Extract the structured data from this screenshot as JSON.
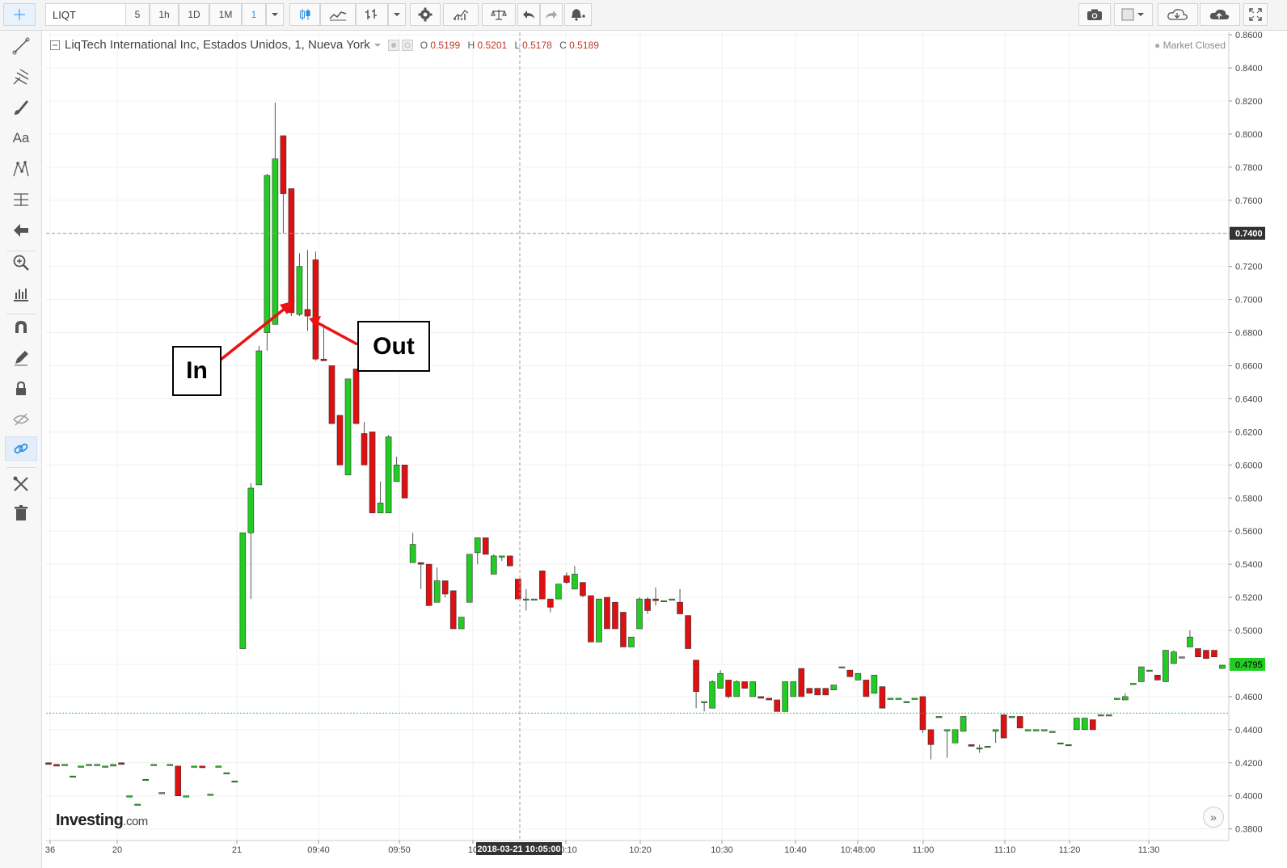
{
  "toolbar": {
    "symbol": "LIQT",
    "intervals": [
      "5",
      "1h",
      "1D",
      "1M",
      "1"
    ],
    "active_interval": "1"
  },
  "legend": {
    "title": "LiqTech International Inc, Estados Unidos, 1, Nueva York",
    "open_label": "O",
    "open": "0.5199",
    "high_label": "H",
    "high": "0.5201",
    "low_label": "L",
    "low": "0.5178",
    "close_label": "C",
    "close": "0.5189"
  },
  "status": "Market Closed",
  "annotations": {
    "in": "In",
    "out": "Out"
  },
  "brand": {
    "name": "Investing",
    "suffix": ".com"
  },
  "crosshair": {
    "time_label": "2018-03-21 10:05:00",
    "price_label": "0.7400"
  },
  "last_price_label": "0.4795",
  "colors": {
    "up": "#22cc22",
    "down": "#dd1111",
    "crosshair": "#999999",
    "last_price": "#22cc22",
    "arrows": "#ee1111"
  },
  "chart_data": {
    "type": "candlestick",
    "y_axis_labels": [
      "0.8600",
      "0.8400",
      "0.8200",
      "0.8000",
      "0.7800",
      "0.7600",
      "0.7400",
      "0.7200",
      "0.7000",
      "0.6800",
      "0.6600",
      "0.6400",
      "0.6200",
      "0.6000",
      "0.5800",
      "0.5600",
      "0.5400",
      "0.5200",
      "0.5000",
      "0.4795",
      "0.4600",
      "0.4400",
      "0.4200",
      "0.4000",
      "0.3800"
    ],
    "x_axis_labels": [
      "36",
      "20",
      "21",
      "09:40",
      "09:50",
      "10",
      "10:10",
      "10:20",
      "10:30",
      "10:40",
      "10:48:00",
      "11:00",
      "11:10",
      "11:20",
      "11:30"
    ],
    "ylim": [
      0.373,
      0.8615
    ],
    "grid": true,
    "candles": [
      {
        "o": 0.42,
        "h": 0.42,
        "l": 0.419,
        "c": 0.419
      },
      {
        "o": 0.419,
        "h": 0.419,
        "l": 0.418,
        "c": 0.418
      },
      {
        "o": 0.419,
        "h": 0.419,
        "l": 0.419,
        "c": 0.419
      },
      {
        "o": 0.412,
        "h": 0.412,
        "l": 0.412,
        "c": 0.412
      },
      {
        "o": 0.418,
        "h": 0.418,
        "l": 0.418,
        "c": 0.418
      },
      {
        "o": 0.419,
        "h": 0.419,
        "l": 0.419,
        "c": 0.419
      },
      {
        "o": 0.419,
        "h": 0.419,
        "l": 0.419,
        "c": 0.419
      },
      {
        "o": 0.418,
        "h": 0.418,
        "l": 0.418,
        "c": 0.418
      },
      {
        "o": 0.418,
        "h": 0.419,
        "l": 0.418,
        "c": 0.419
      },
      {
        "o": 0.42,
        "h": 0.42,
        "l": 0.419,
        "c": 0.419
      },
      {
        "o": 0.4,
        "h": 0.4,
        "l": 0.4,
        "c": 0.4
      },
      {
        "o": 0.395,
        "h": 0.395,
        "l": 0.395,
        "c": 0.395
      },
      {
        "o": 0.41,
        "h": 0.41,
        "l": 0.41,
        "c": 0.41
      },
      {
        "o": 0.419,
        "h": 0.419,
        "l": 0.419,
        "c": 0.419
      },
      {
        "o": 0.402,
        "h": 0.402,
        "l": 0.402,
        "c": 0.402
      },
      {
        "o": 0.419,
        "h": 0.419,
        "l": 0.419,
        "c": 0.419
      },
      {
        "o": 0.418,
        "h": 0.418,
        "l": 0.4,
        "c": 0.4
      },
      {
        "o": 0.4,
        "h": 0.4,
        "l": 0.4,
        "c": 0.4
      },
      {
        "o": 0.418,
        "h": 0.418,
        "l": 0.418,
        "c": 0.418
      },
      {
        "o": 0.418,
        "h": 0.418,
        "l": 0.417,
        "c": 0.417
      },
      {
        "o": 0.401,
        "h": 0.401,
        "l": 0.401,
        "c": 0.401
      },
      {
        "o": 0.418,
        "h": 0.418,
        "l": 0.418,
        "c": 0.418
      },
      {
        "o": 0.414,
        "h": 0.414,
        "l": 0.414,
        "c": 0.414
      },
      {
        "o": 0.409,
        "h": 0.409,
        "l": 0.409,
        "c": 0.409
      },
      {
        "o": 0.489,
        "h": 0.559,
        "l": 0.489,
        "c": 0.559
      },
      {
        "o": 0.559,
        "h": 0.589,
        "l": 0.519,
        "c": 0.586
      },
      {
        "o": 0.588,
        "h": 0.672,
        "l": 0.588,
        "c": 0.669
      },
      {
        "o": 0.68,
        "h": 0.776,
        "l": 0.669,
        "c": 0.775
      },
      {
        "o": 0.685,
        "h": 0.819,
        "l": 0.685,
        "c": 0.785
      },
      {
        "o": 0.799,
        "h": 0.799,
        "l": 0.74,
        "c": 0.764
      },
      {
        "o": 0.767,
        "h": 0.767,
        "l": 0.69,
        "c": 0.692
      },
      {
        "o": 0.691,
        "h": 0.728,
        "l": 0.69,
        "c": 0.72
      },
      {
        "o": 0.694,
        "h": 0.73,
        "l": 0.681,
        "c": 0.69
      },
      {
        "o": 0.724,
        "h": 0.729,
        "l": 0.663,
        "c": 0.664
      },
      {
        "o": 0.664,
        "h": 0.685,
        "l": 0.664,
        "c": 0.663
      },
      {
        "o": 0.66,
        "h": 0.66,
        "l": 0.625,
        "c": 0.625
      },
      {
        "o": 0.63,
        "h": 0.63,
        "l": 0.6,
        "c": 0.6
      },
      {
        "o": 0.594,
        "h": 0.652,
        "l": 0.594,
        "c": 0.652
      },
      {
        "o": 0.658,
        "h": 0.658,
        "l": 0.625,
        "c": 0.625
      },
      {
        "o": 0.619,
        "h": 0.626,
        "l": 0.6,
        "c": 0.6
      },
      {
        "o": 0.62,
        "h": 0.62,
        "l": 0.572,
        "c": 0.571
      },
      {
        "o": 0.571,
        "h": 0.59,
        "l": 0.571,
        "c": 0.577
      },
      {
        "o": 0.571,
        "h": 0.618,
        "l": 0.571,
        "c": 0.617
      },
      {
        "o": 0.59,
        "h": 0.605,
        "l": 0.59,
        "c": 0.6
      },
      {
        "o": 0.6,
        "h": 0.6,
        "l": 0.58,
        "c": 0.58
      },
      {
        "o": 0.541,
        "h": 0.559,
        "l": 0.541,
        "c": 0.552
      },
      {
        "o": 0.541,
        "h": 0.541,
        "l": 0.525,
        "c": 0.54
      },
      {
        "o": 0.54,
        "h": 0.54,
        "l": 0.515,
        "c": 0.515
      },
      {
        "o": 0.517,
        "h": 0.538,
        "l": 0.517,
        "c": 0.53
      },
      {
        "o": 0.53,
        "h": 0.53,
        "l": 0.52,
        "c": 0.522
      },
      {
        "o": 0.524,
        "h": 0.524,
        "l": 0.501,
        "c": 0.501
      },
      {
        "o": 0.501,
        "h": 0.508,
        "l": 0.501,
        "c": 0.508
      },
      {
        "o": 0.517,
        "h": 0.546,
        "l": 0.517,
        "c": 0.546
      },
      {
        "o": 0.547,
        "h": 0.556,
        "l": 0.54,
        "c": 0.556
      },
      {
        "o": 0.556,
        "h": 0.556,
        "l": 0.546,
        "c": 0.546
      },
      {
        "o": 0.534,
        "h": 0.546,
        "l": 0.534,
        "c": 0.545
      },
      {
        "o": 0.545,
        "h": 0.545,
        "l": 0.542,
        "c": 0.545
      },
      {
        "o": 0.545,
        "h": 0.545,
        "l": 0.539,
        "c": 0.539
      },
      {
        "o": 0.531,
        "h": 0.531,
        "l": 0.52,
        "c": 0.519
      },
      {
        "o": 0.519,
        "h": 0.525,
        "l": 0.512,
        "c": 0.519
      },
      {
        "o": 0.519,
        "h": 0.519,
        "l": 0.519,
        "c": 0.519
      },
      {
        "o": 0.536,
        "h": 0.536,
        "l": 0.519,
        "c": 0.519
      },
      {
        "o": 0.519,
        "h": 0.519,
        "l": 0.511,
        "c": 0.514
      },
      {
        "o": 0.519,
        "h": 0.528,
        "l": 0.519,
        "c": 0.528
      },
      {
        "o": 0.533,
        "h": 0.535,
        "l": 0.528,
        "c": 0.529
      },
      {
        "o": 0.525,
        "h": 0.539,
        "l": 0.525,
        "c": 0.534
      },
      {
        "o": 0.529,
        "h": 0.529,
        "l": 0.52,
        "c": 0.521
      },
      {
        "o": 0.521,
        "h": 0.521,
        "l": 0.493,
        "c": 0.493
      },
      {
        "o": 0.493,
        "h": 0.519,
        "l": 0.493,
        "c": 0.519
      },
      {
        "o": 0.52,
        "h": 0.52,
        "l": 0.501,
        "c": 0.501
      },
      {
        "o": 0.517,
        "h": 0.517,
        "l": 0.501,
        "c": 0.501
      },
      {
        "o": 0.511,
        "h": 0.511,
        "l": 0.49,
        "c": 0.49
      },
      {
        "o": 0.49,
        "h": 0.496,
        "l": 0.49,
        "c": 0.496
      },
      {
        "o": 0.501,
        "h": 0.52,
        "l": 0.501,
        "c": 0.519
      },
      {
        "o": 0.519,
        "h": 0.52,
        "l": 0.51,
        "c": 0.512
      },
      {
        "o": 0.519,
        "h": 0.526,
        "l": 0.515,
        "c": 0.518
      },
      {
        "o": 0.518,
        "h": 0.518,
        "l": 0.518,
        "c": 0.518
      },
      {
        "o": 0.519,
        "h": 0.519,
        "l": 0.519,
        "c": 0.519
      },
      {
        "o": 0.517,
        "h": 0.525,
        "l": 0.51,
        "c": 0.51
      },
      {
        "o": 0.509,
        "h": 0.509,
        "l": 0.489,
        "c": 0.489
      },
      {
        "o": 0.482,
        "h": 0.482,
        "l": 0.453,
        "c": 0.463
      },
      {
        "o": 0.457,
        "h": 0.457,
        "l": 0.451,
        "c": 0.457
      },
      {
        "o": 0.453,
        "h": 0.47,
        "l": 0.453,
        "c": 0.469
      },
      {
        "o": 0.465,
        "h": 0.476,
        "l": 0.465,
        "c": 0.474
      },
      {
        "o": 0.47,
        "h": 0.47,
        "l": 0.459,
        "c": 0.46
      },
      {
        "o": 0.46,
        "h": 0.47,
        "l": 0.46,
        "c": 0.469
      },
      {
        "o": 0.469,
        "h": 0.469,
        "l": 0.465,
        "c": 0.465
      },
      {
        "o": 0.46,
        "h": 0.469,
        "l": 0.46,
        "c": 0.469
      },
      {
        "o": 0.46,
        "h": 0.46,
        "l": 0.459,
        "c": 0.459
      },
      {
        "o": 0.459,
        "h": 0.459,
        "l": 0.458,
        "c": 0.458
      },
      {
        "o": 0.458,
        "h": 0.458,
        "l": 0.451,
        "c": 0.451
      },
      {
        "o": 0.451,
        "h": 0.469,
        "l": 0.451,
        "c": 0.469
      },
      {
        "o": 0.46,
        "h": 0.469,
        "l": 0.46,
        "c": 0.469
      },
      {
        "o": 0.477,
        "h": 0.477,
        "l": 0.46,
        "c": 0.46
      },
      {
        "o": 0.465,
        "h": 0.465,
        "l": 0.462,
        "c": 0.462
      },
      {
        "o": 0.465,
        "h": 0.465,
        "l": 0.461,
        "c": 0.461
      },
      {
        "o": 0.465,
        "h": 0.465,
        "l": 0.461,
        "c": 0.461
      },
      {
        "o": 0.464,
        "h": 0.467,
        "l": 0.464,
        "c": 0.467
      },
      {
        "o": 0.478,
        "h": 0.478,
        "l": 0.478,
        "c": 0.478
      },
      {
        "o": 0.476,
        "h": 0.476,
        "l": 0.472,
        "c": 0.472
      },
      {
        "o": 0.47,
        "h": 0.474,
        "l": 0.47,
        "c": 0.474
      },
      {
        "o": 0.47,
        "h": 0.47,
        "l": 0.46,
        "c": 0.46
      },
      {
        "o": 0.462,
        "h": 0.473,
        "l": 0.462,
        "c": 0.473
      },
      {
        "o": 0.466,
        "h": 0.466,
        "l": 0.453,
        "c": 0.453
      },
      {
        "o": 0.459,
        "h": 0.459,
        "l": 0.459,
        "c": 0.459
      },
      {
        "o": 0.459,
        "h": 0.459,
        "l": 0.459,
        "c": 0.459
      },
      {
        "o": 0.457,
        "h": 0.457,
        "l": 0.457,
        "c": 0.457
      },
      {
        "o": 0.459,
        "h": 0.459,
        "l": 0.459,
        "c": 0.459
      },
      {
        "o": 0.46,
        "h": 0.46,
        "l": 0.438,
        "c": 0.44
      },
      {
        "o": 0.44,
        "h": 0.44,
        "l": 0.422,
        "c": 0.431
      },
      {
        "o": 0.448,
        "h": 0.448,
        "l": 0.448,
        "c": 0.448
      },
      {
        "o": 0.44,
        "h": 0.44,
        "l": 0.423,
        "c": 0.44
      },
      {
        "o": 0.432,
        "h": 0.44,
        "l": 0.432,
        "c": 0.44
      },
      {
        "o": 0.439,
        "h": 0.448,
        "l": 0.439,
        "c": 0.448
      },
      {
        "o": 0.431,
        "h": 0.431,
        "l": 0.43,
        "c": 0.43
      },
      {
        "o": 0.429,
        "h": 0.431,
        "l": 0.426,
        "c": 0.429
      },
      {
        "o": 0.43,
        "h": 0.43,
        "l": 0.43,
        "c": 0.43
      },
      {
        "o": 0.439,
        "h": 0.44,
        "l": 0.432,
        "c": 0.44
      },
      {
        "o": 0.449,
        "h": 0.449,
        "l": 0.435,
        "c": 0.435
      },
      {
        "o": 0.448,
        "h": 0.448,
        "l": 0.448,
        "c": 0.448
      },
      {
        "o": 0.448,
        "h": 0.448,
        "l": 0.441,
        "c": 0.441
      },
      {
        "o": 0.44,
        "h": 0.44,
        "l": 0.44,
        "c": 0.44
      },
      {
        "o": 0.44,
        "h": 0.44,
        "l": 0.44,
        "c": 0.44
      },
      {
        "o": 0.44,
        "h": 0.44,
        "l": 0.44,
        "c": 0.44
      },
      {
        "o": 0.439,
        "h": 0.439,
        "l": 0.439,
        "c": 0.439
      },
      {
        "o": 0.432,
        "h": 0.432,
        "l": 0.432,
        "c": 0.432
      },
      {
        "o": 0.431,
        "h": 0.431,
        "l": 0.431,
        "c": 0.431
      },
      {
        "o": 0.44,
        "h": 0.447,
        "l": 0.44,
        "c": 0.447
      },
      {
        "o": 0.44,
        "h": 0.447,
        "l": 0.44,
        "c": 0.447
      },
      {
        "o": 0.446,
        "h": 0.446,
        "l": 0.44,
        "c": 0.44
      },
      {
        "o": 0.449,
        "h": 0.449,
        "l": 0.449,
        "c": 0.449
      },
      {
        "o": 0.449,
        "h": 0.449,
        "l": 0.449,
        "c": 0.449
      },
      {
        "o": 0.459,
        "h": 0.459,
        "l": 0.459,
        "c": 0.459
      },
      {
        "o": 0.458,
        "h": 0.462,
        "l": 0.458,
        "c": 0.46
      },
      {
        "o": 0.468,
        "h": 0.468,
        "l": 0.468,
        "c": 0.468
      },
      {
        "o": 0.469,
        "h": 0.478,
        "l": 0.469,
        "c": 0.478
      },
      {
        "o": 0.476,
        "h": 0.476,
        "l": 0.476,
        "c": 0.476
      },
      {
        "o": 0.473,
        "h": 0.473,
        "l": 0.47,
        "c": 0.47
      },
      {
        "o": 0.469,
        "h": 0.488,
        "l": 0.469,
        "c": 0.488
      },
      {
        "o": 0.48,
        "h": 0.488,
        "l": 0.48,
        "c": 0.487
      },
      {
        "o": 0.484,
        "h": 0.484,
        "l": 0.484,
        "c": 0.484
      },
      {
        "o": 0.49,
        "h": 0.5,
        "l": 0.49,
        "c": 0.496
      },
      {
        "o": 0.489,
        "h": 0.489,
        "l": 0.484,
        "c": 0.484
      },
      {
        "o": 0.488,
        "h": 0.488,
        "l": 0.483,
        "c": 0.483
      },
      {
        "o": 0.488,
        "h": 0.488,
        "l": 0.484,
        "c": 0.484
      },
      {
        "o": 0.477,
        "h": 0.479,
        "l": 0.477,
        "c": 0.479
      }
    ],
    "horizontal_levels": [
      {
        "value": 0.4795,
        "label": "0.4795",
        "style": "last-price"
      },
      {
        "value": 0.45,
        "style": "dotted"
      },
      {
        "value": 0.74,
        "label": "0.7400",
        "style": "crosshair"
      }
    ]
  }
}
